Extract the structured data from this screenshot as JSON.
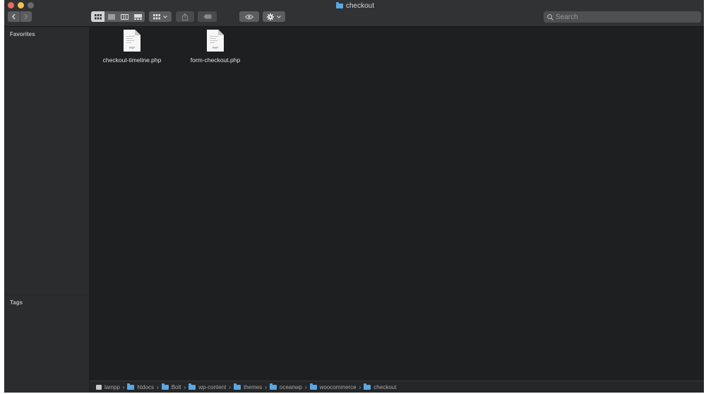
{
  "window": {
    "title": "checkout",
    "title_icon": "folder-icon"
  },
  "toolbar": {
    "back_icon": "chevron-left-icon",
    "forward_icon": "chevron-right-icon",
    "view_modes": [
      "icon-view",
      "list-view",
      "column-view",
      "gallery-view"
    ],
    "active_view": "icon-view",
    "group_icon": "grid-group-icon",
    "share_icon": "share-icon",
    "tag_icon": "tag-icon",
    "quicklook_icon": "eye-icon",
    "action_icon": "gear-icon"
  },
  "search": {
    "placeholder": "Search"
  },
  "sidebar": {
    "favorites_label": "Favorites",
    "tags_label": "Tags"
  },
  "files": [
    {
      "name": "checkout-timeline.php",
      "type_badge": "PHP"
    },
    {
      "name": "form-checkout.php",
      "type_badge": "PHP"
    }
  ],
  "pathbar": [
    {
      "label": "lampp",
      "icon": "drive-icon"
    },
    {
      "label": "htdocs",
      "icon": "folder-icon"
    },
    {
      "label": "Bolt",
      "icon": "folder-icon"
    },
    {
      "label": "wp-content",
      "icon": "folder-icon"
    },
    {
      "label": "themes",
      "icon": "folder-icon"
    },
    {
      "label": "oceanwp",
      "icon": "folder-icon"
    },
    {
      "label": "woocommerce",
      "icon": "folder-icon"
    },
    {
      "label": "checkout",
      "icon": "folder-icon"
    }
  ],
  "colors": {
    "close": "#ed6a5e",
    "minimize": "#f5bf4f",
    "folder_accent": "#5aa7e3",
    "background": "#1e1f21"
  }
}
